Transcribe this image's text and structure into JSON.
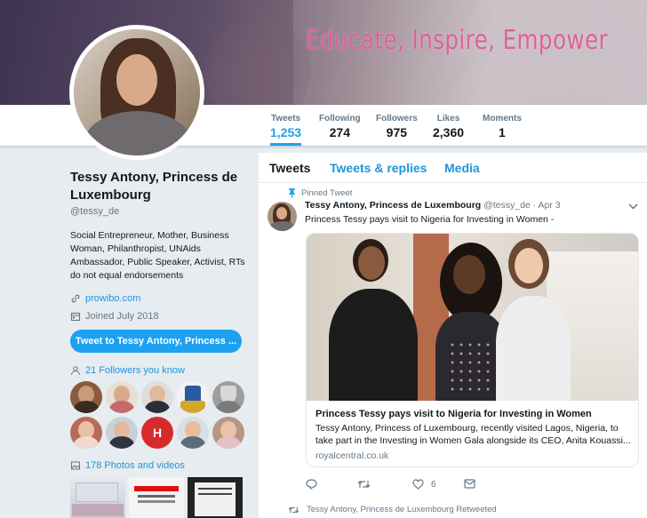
{
  "banner": {
    "text": "Educate, Inspire, Empower"
  },
  "nav": {
    "stats": [
      {
        "label": "Tweets",
        "value": "1,253",
        "active": true
      },
      {
        "label": "Following",
        "value": "274"
      },
      {
        "label": "Followers",
        "value": "975"
      },
      {
        "label": "Likes",
        "value": "2,360"
      },
      {
        "label": "Moments",
        "value": "1"
      }
    ]
  },
  "profile": {
    "name": "Tessy Antony, Princess de Luxembourg",
    "handle": "@tessy_de",
    "bio": "Social Entrepreneur, Mother, Business Woman, Philanthropist, UNAids Ambassador, Public Speaker, Activist, RTs do not equal endorsements",
    "website": "prowibo.com",
    "joined": "Joined July 2018",
    "tweet_to_button": "Tweet to Tessy Antony, Princess ...",
    "followers_you_know": "21 Followers you know",
    "photos_videos": "178 Photos and videos"
  },
  "timeline": {
    "tabs": [
      "Tweets",
      "Tweets & replies",
      "Media"
    ],
    "pinned_tweet": {
      "pinned_label": "Pinned Tweet",
      "author_name": "Tessy Antony, Princess de Luxembourg",
      "author_handle": "@tessy_de",
      "date": "· Apr 3",
      "text": "Princess Tessy pays visit to Nigeria for Investing in Women -",
      "card": {
        "title": "Princess Tessy pays visit to Nigeria for Investing in Women",
        "description": "Tessy Antony, Princess of Luxembourg, recently visited Lagos, Nigeria, to take part in the Investing in Women Gala alongside its CEO, Anita Kouassi...",
        "domain": "royalcentral.co.uk"
      },
      "likes": "6"
    },
    "retweet_context": "Tessy Antony, Princess de Luxembourg Retweeted"
  },
  "colors": {
    "accent": "#1da1f2",
    "link": "#1b95e0",
    "banner_text": "#e05f9c"
  },
  "icons": [
    "pin-icon",
    "link-icon",
    "calendar-icon",
    "people-icon",
    "photo-icon",
    "reply-icon",
    "retweet-icon",
    "like-icon",
    "message-icon",
    "chevron-down-icon"
  ]
}
